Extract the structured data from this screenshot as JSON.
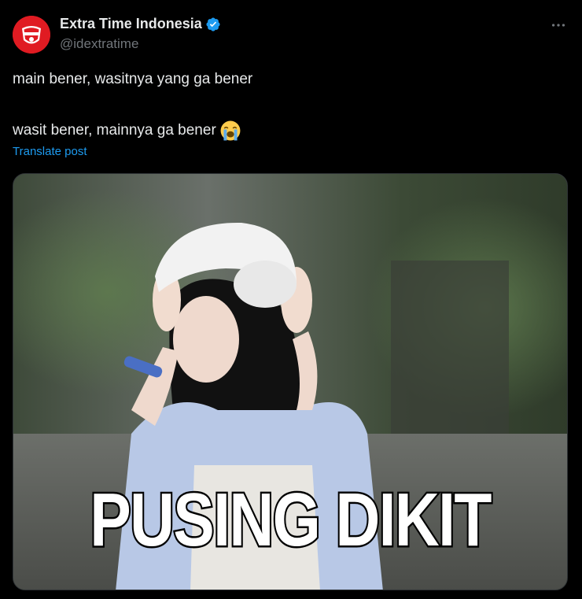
{
  "post": {
    "author": {
      "display_name": "Extra Time Indonesia",
      "handle": "@idextratime",
      "verified": true,
      "avatar_icon": "extra-time-logo-icon",
      "avatar_color": "#e01b22"
    },
    "more_icon": "more-horizontal-icon",
    "text_line1": "main bener, wasitnya yang ga bener",
    "text_line2": "wasit bener, mainnya ga bener",
    "text_line2_emoji": "loudly-crying-face-emoji",
    "translate_label": "Translate post",
    "media": {
      "caption": "PUSING DIKIT",
      "description_icon": "photo"
    }
  },
  "colors": {
    "background": "#000000",
    "text_primary": "#e7e9ea",
    "text_secondary": "#71767b",
    "link": "#1d9bf0",
    "verified": "#1d9bf0"
  }
}
